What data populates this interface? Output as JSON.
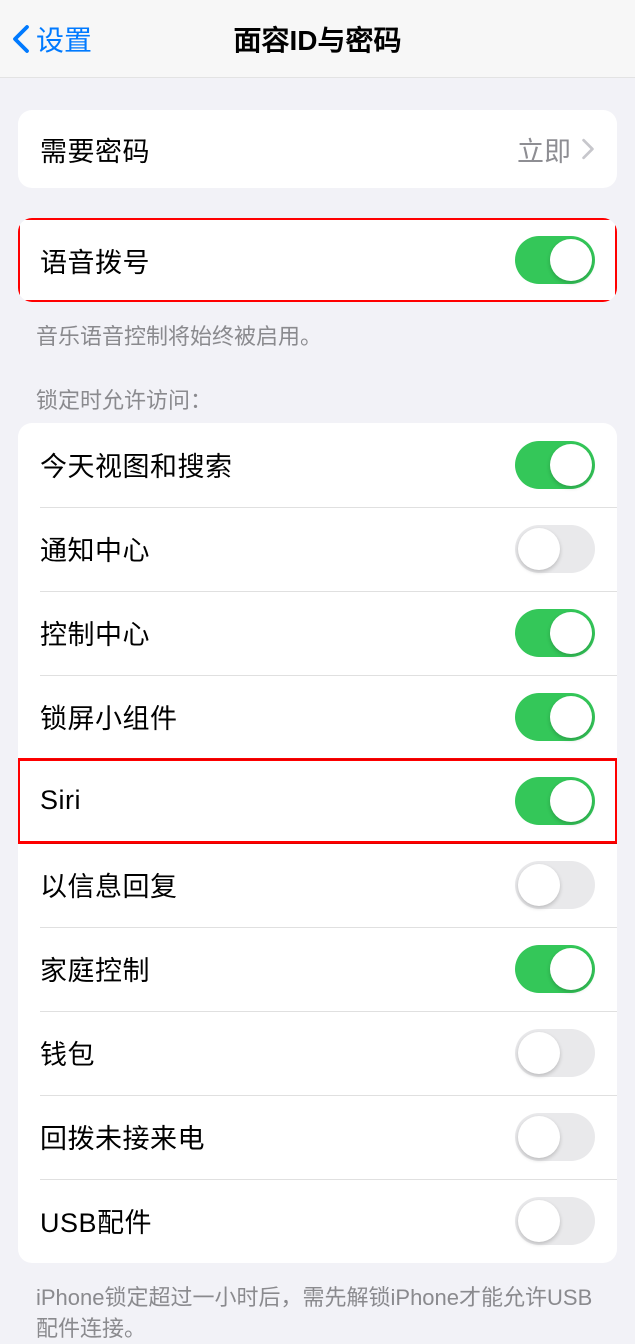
{
  "nav": {
    "back": "设置",
    "title": "面容ID与密码"
  },
  "group1": {
    "require_passcode": {
      "label": "需要密码",
      "value": "立即"
    }
  },
  "group2": {
    "voice_dial": {
      "label": "语音拨号",
      "on": true
    },
    "footer": "音乐语音控制将始终被启用。"
  },
  "group3": {
    "header": "锁定时允许访问：",
    "items": [
      {
        "label": "今天视图和搜索",
        "on": true
      },
      {
        "label": "通知中心",
        "on": false
      },
      {
        "label": "控制中心",
        "on": true
      },
      {
        "label": "锁屏小组件",
        "on": true
      },
      {
        "label": "Siri",
        "on": true
      },
      {
        "label": "以信息回复",
        "on": false
      },
      {
        "label": "家庭控制",
        "on": true
      },
      {
        "label": "钱包",
        "on": false
      },
      {
        "label": "回拨未接来电",
        "on": false
      },
      {
        "label": "USB配件",
        "on": false
      }
    ],
    "footer": "iPhone锁定超过一小时后，需先解锁iPhone才能允许USB配件连接。"
  },
  "highlighted": [
    "voice-dial-row",
    "item-4-row"
  ]
}
